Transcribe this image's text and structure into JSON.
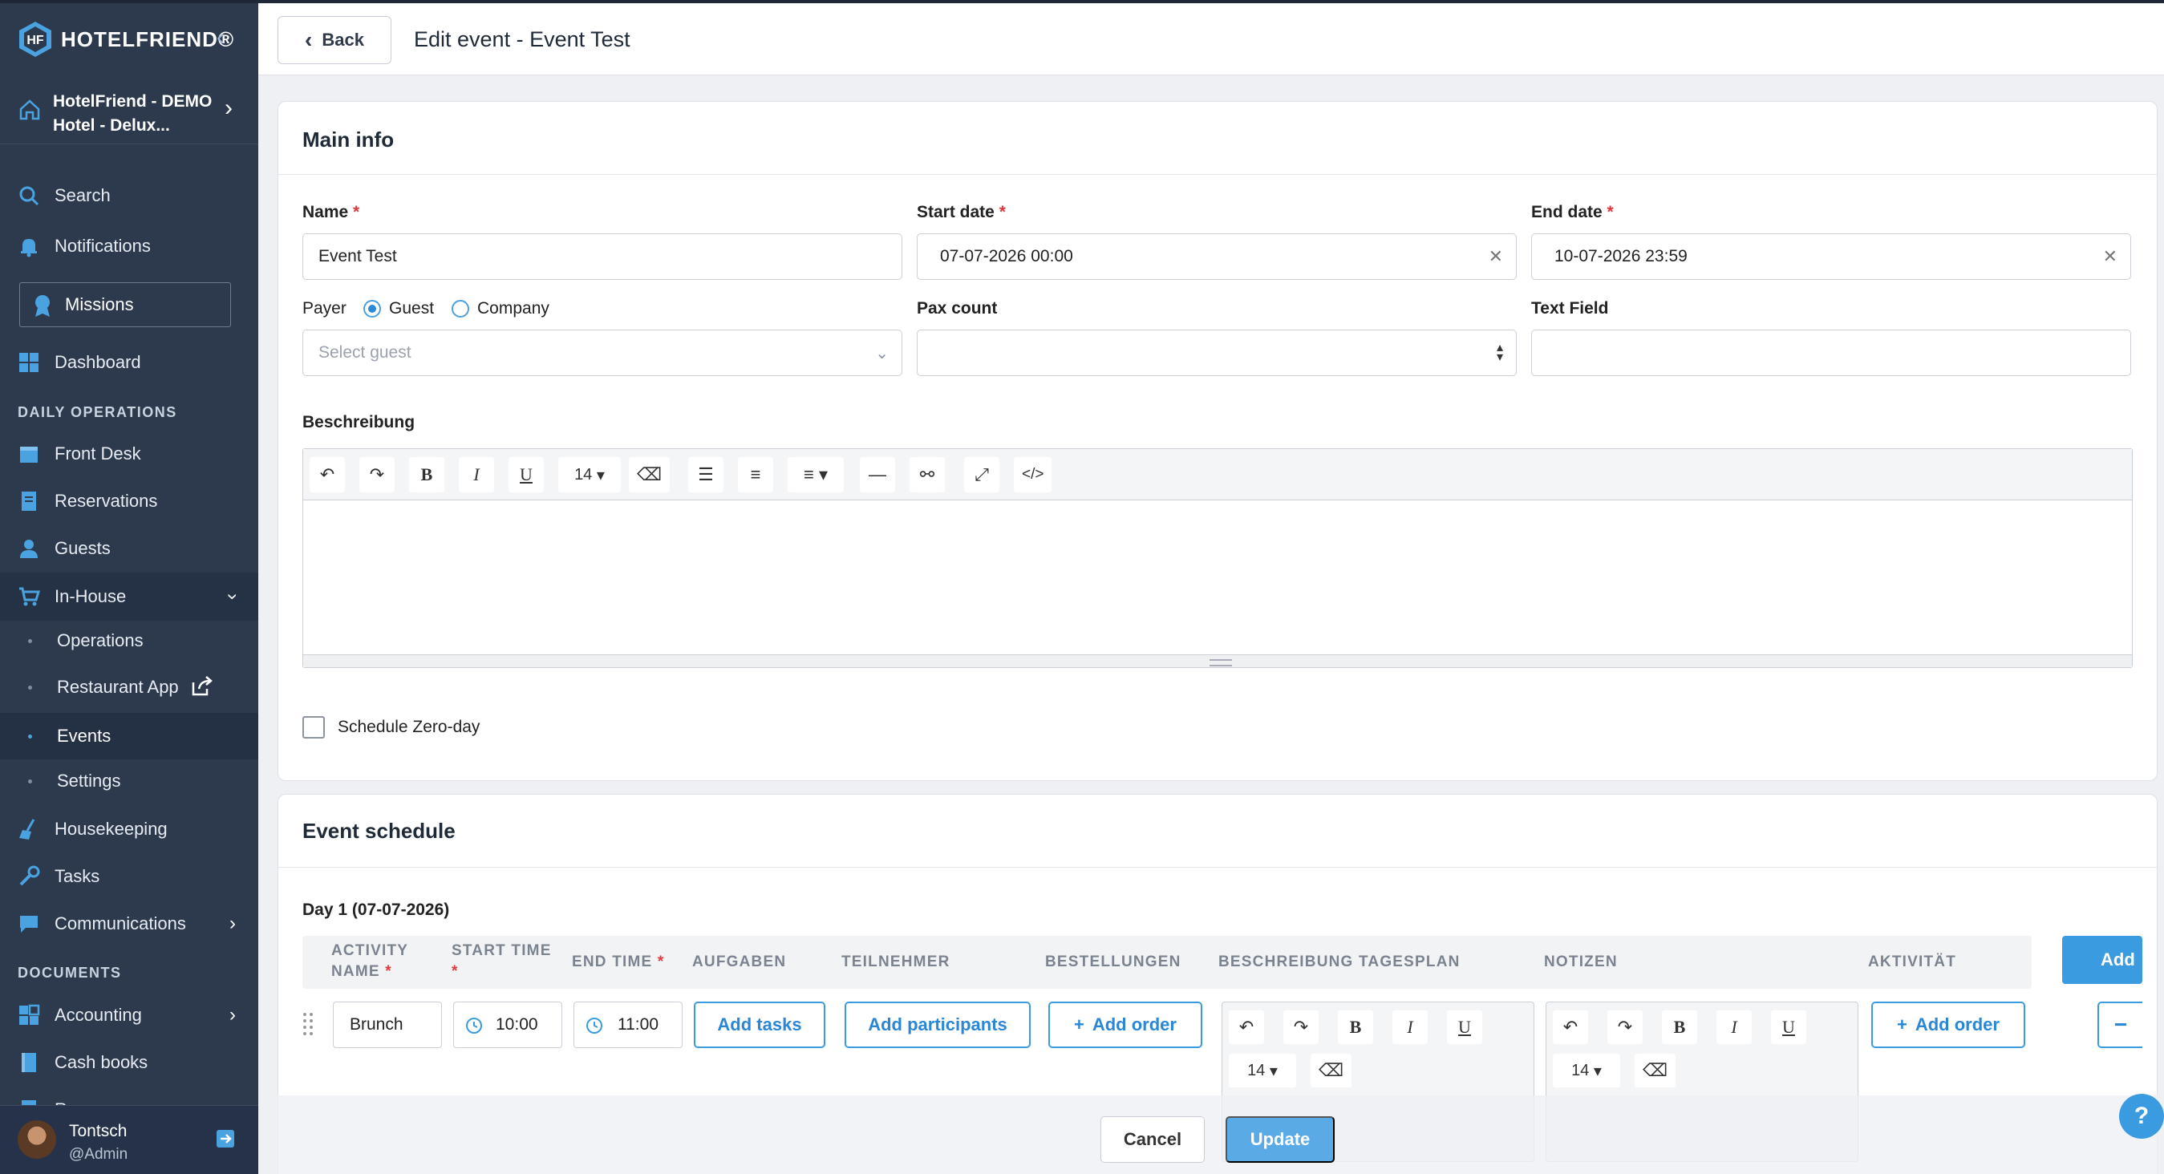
{
  "brand": {
    "name": "HOTELFRIEND®"
  },
  "hotel": {
    "line1": "HotelFriend - DEMO",
    "line2": "Hotel - Delux..."
  },
  "sidebar": {
    "search": "Search",
    "notifications": "Notifications",
    "missions": "Missions",
    "dashboard": "Dashboard",
    "section_daily": "DAILY OPERATIONS",
    "front_desk": "Front Desk",
    "reservations": "Reservations",
    "guests": "Guests",
    "in_house": "In-House",
    "in_house_items": [
      "Operations",
      "Restaurant App",
      "Events",
      "Settings"
    ],
    "housekeeping": "Housekeeping",
    "tasks": "Tasks",
    "communications": "Communications",
    "section_documents": "DOCUMENTS",
    "accounting": "Accounting",
    "cash_books": "Cash books",
    "cut_item": "Rep..."
  },
  "user": {
    "name": "Tontsch",
    "role": "@Admin"
  },
  "header": {
    "back_label": "Back",
    "title": "Edit event - Event Test"
  },
  "main_info": {
    "title": "Main info",
    "name_label": "Name",
    "name_value": "Event Test",
    "start_label": "Start date",
    "start_value": "07-07-2026 00:00",
    "end_label": "End date",
    "end_value": "10-07-2026 23:59",
    "payer_label": "Payer",
    "payer_options": [
      "Guest",
      "Company"
    ],
    "payer_selected": "Guest",
    "guest_placeholder": "Select guest",
    "pax_label": "Pax count",
    "pax_value": "",
    "text_field_label": "Text Field",
    "text_field_value": "",
    "description_label": "Beschreibung",
    "font_size": "14",
    "zero_day_label": "Schedule Zero-day",
    "zero_day_checked": false
  },
  "schedule": {
    "title": "Event schedule",
    "day_label": "Day 1 (07-07-2026)",
    "columns": [
      "ACTIVITY NAME",
      "START TIME",
      "END TIME",
      "AUFGABEN",
      "TEILNEHMER",
      "BESTELLUNGEN",
      "BESCHREIBUNG TAGESPLAN",
      "NOTIZEN",
      "AKTIVITÄT"
    ],
    "add_label": "Add",
    "row": {
      "activity": "Brunch",
      "start": "10:00",
      "end": "11:00",
      "add_tasks": "Add tasks",
      "add_participants": "Add participants",
      "add_order": "Add order",
      "add_order_2": "Add order",
      "font_size": "14"
    }
  },
  "footer": {
    "cancel": "Cancel",
    "update": "Update",
    "help": "?"
  }
}
